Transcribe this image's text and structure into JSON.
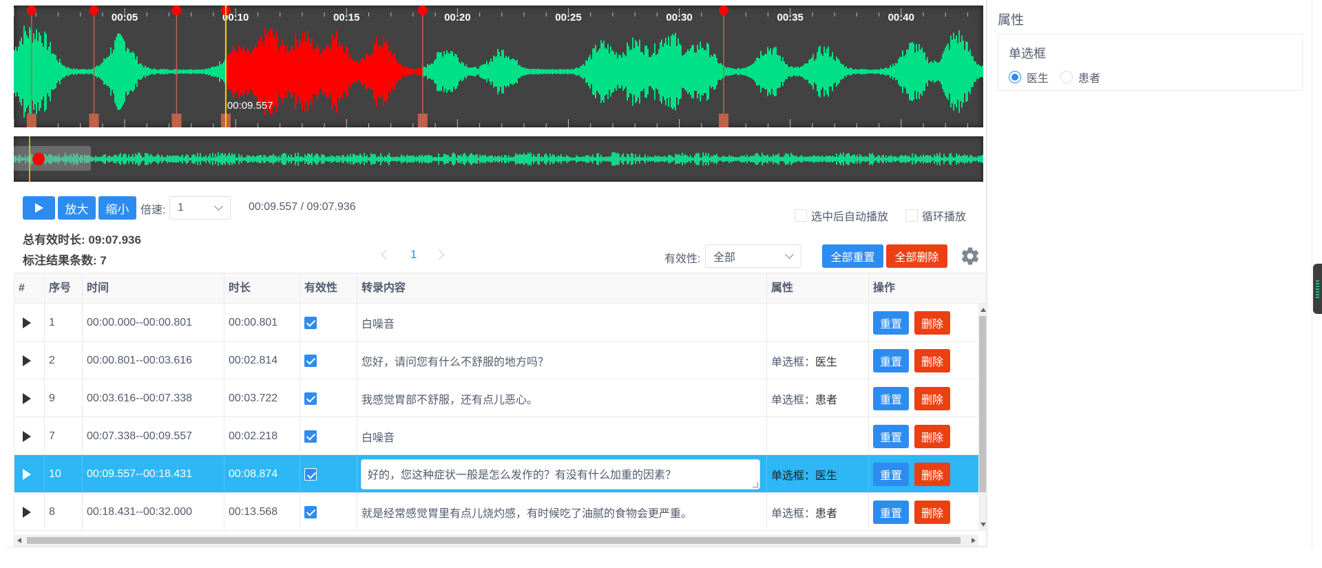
{
  "waveform": {
    "time_ticks": [
      "00:05",
      "00:10",
      "00:15",
      "00:20",
      "00:25",
      "00:30",
      "00:35",
      "00:40"
    ],
    "tick_seconds": [
      5,
      10,
      15,
      20,
      25,
      30,
      35,
      40
    ],
    "visible_seconds": 43.7,
    "cursor_label": "00:09.557",
    "cursor_seconds": 9.557,
    "region_boundaries_seconds": [
      0.801,
      3.616,
      7.338,
      9.557,
      18.431,
      32.0
    ],
    "selected_region_seconds": [
      9.557,
      18.431
    ],
    "wave_color": "#00e087",
    "selected_color": "#ff0000",
    "boundary_color": "#c0614a",
    "cursor_color": "#ffd400",
    "minimap_color": "#14d68a"
  },
  "controls": {
    "zoom_in_label": "放大",
    "zoom_out_label": "缩小",
    "speed_label": "倍速:",
    "speed_value": "1",
    "time_readout": "00:09.557 / 09:07.936",
    "autoplay_label": "选中后自动播放",
    "loop_label": "循环播放"
  },
  "stats": {
    "total_duration": "总有效时长: 09:07.936",
    "result_count": "标注结果条数: 7"
  },
  "pagination": {
    "current": "1"
  },
  "filter": {
    "validity_label": "有效性:",
    "validity_value": "全部",
    "reset_all_label": "全部重置",
    "delete_all_label": "全部删除"
  },
  "table": {
    "headers": {
      "hash": "#",
      "index": "序号",
      "time": "时间",
      "duration": "时长",
      "validity": "有效性",
      "transcript": "转录内容",
      "attribute": "属性",
      "actions": "操作"
    },
    "reset_label": "重置",
    "delete_label": "删除",
    "rows": [
      {
        "index": "1",
        "time": "00:00.000--00:00.801",
        "duration": "00:00.801",
        "transcript": "白噪音",
        "attr_key": "",
        "attr_val": ""
      },
      {
        "index": "2",
        "time": "00:00.801--00:03.616",
        "duration": "00:02.814",
        "transcript": "您好，请问您有什么不舒服的地方吗？",
        "attr_key": "单选框：",
        "attr_val": "医生"
      },
      {
        "index": "9",
        "time": "00:03.616--00:07.338",
        "duration": "00:03.722",
        "transcript": "我感觉胃部不舒服，还有点儿恶心。",
        "attr_key": "单选框：",
        "attr_val": "患者"
      },
      {
        "index": "7",
        "time": "00:07.338--00:09.557",
        "duration": "00:02.218",
        "transcript": "白噪音",
        "attr_key": "",
        "attr_val": ""
      },
      {
        "index": "10",
        "time": "00:09.557--00:18.431",
        "duration": "00:08.874",
        "transcript": "好的，您这种症状一般是怎么发作的？有没有什么加重的因素？",
        "attr_key": "单选框：",
        "attr_val": "医生"
      },
      {
        "index": "8",
        "time": "00:18.431--00:32.000",
        "duration": "00:13.568",
        "transcript": "就是经常感觉胃里有点儿烧灼感，有时候吃了油腻的食物会更严重。",
        "attr_key": "单选框：",
        "attr_val": "患者"
      }
    ]
  },
  "side": {
    "title": "属性",
    "card_title": "单选框",
    "option_doctor": "医生",
    "option_patient": "患者"
  },
  "colors": {
    "primary": "#2d8cf0",
    "danger": "#ed3f14",
    "row_selected": "#2db7f5"
  }
}
